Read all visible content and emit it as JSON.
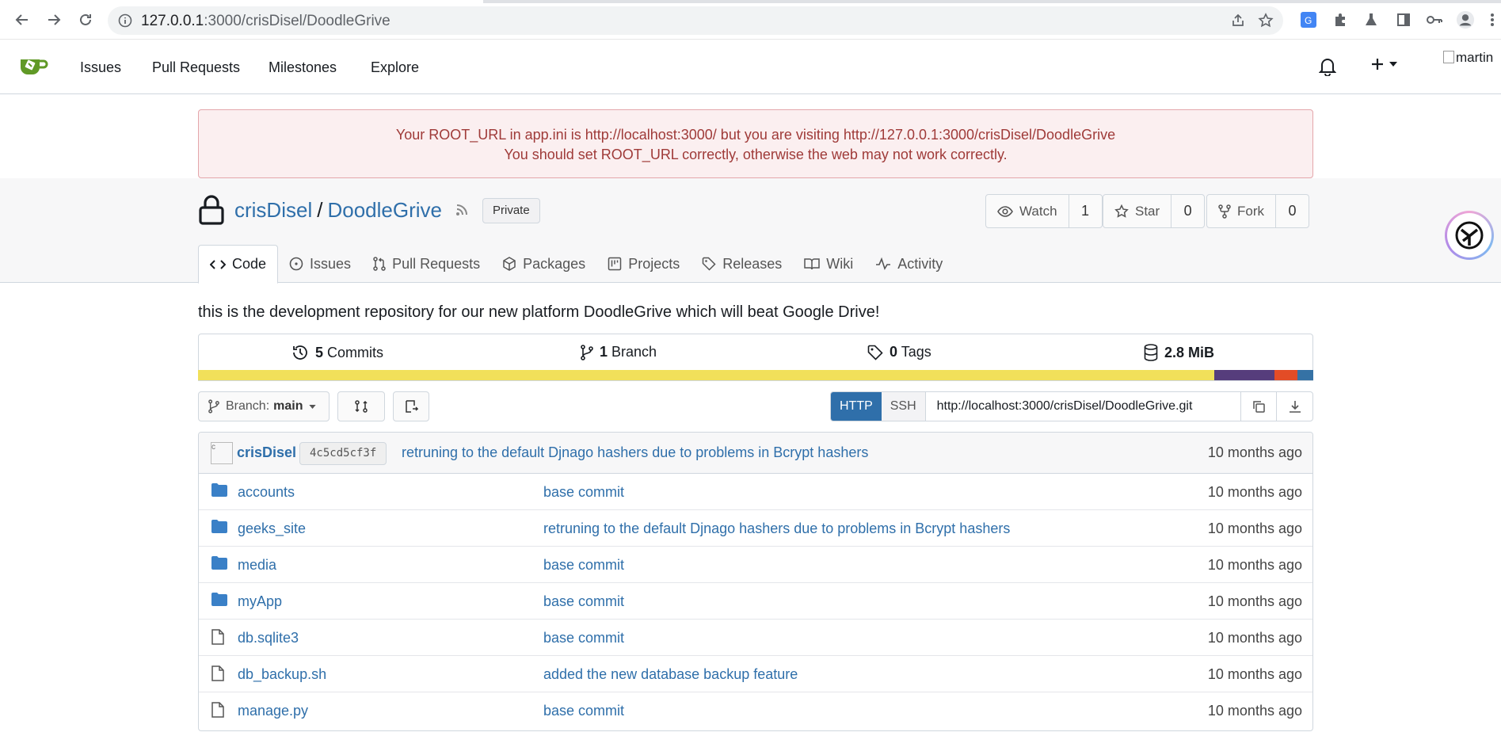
{
  "browser": {
    "url_host": "127.0.0.1",
    "url_path": ":3000/crisDisel/DoodleGrive"
  },
  "navbar": {
    "links": [
      "Issues",
      "Pull Requests",
      "Milestones",
      "Explore"
    ],
    "avatar_alt": "martin"
  },
  "warning": {
    "line1": "Your ROOT_URL in app.ini is http://localhost:3000/ but you are visiting http://127.0.0.1:3000/crisDisel/DoodleGrive",
    "line2": "You should set ROOT_URL correctly, otherwise the web may not work correctly."
  },
  "repo": {
    "owner": "crisDisel",
    "separator": "/",
    "name": "DoodleGrive",
    "visibility": "Private",
    "watch_label": "Watch",
    "watch_count": "1",
    "star_label": "Star",
    "star_count": "0",
    "fork_label": "Fork",
    "fork_count": "0",
    "description": "this is the development repository for our new platform DoodleGrive which will beat Google Drive!"
  },
  "tabs": [
    "Code",
    "Issues",
    "Pull Requests",
    "Packages",
    "Projects",
    "Releases",
    "Wiki",
    "Activity"
  ],
  "stats": {
    "commits_num": "5",
    "commits_label": "Commits",
    "branches_num": "1",
    "branches_label": "Branch",
    "tags_num": "0",
    "tags_label": "Tags",
    "size": "2.8 MiB"
  },
  "languages": [
    {
      "color": "#f1e05a",
      "fraction": 0.911
    },
    {
      "color": "#563d7c",
      "fraction": 0.054
    },
    {
      "color": "#e34c26",
      "fraction": 0.021
    },
    {
      "color": "#3572a5",
      "fraction": 0.014
    }
  ],
  "toolbar": {
    "branch_prefix": "Branch:",
    "branch_name": "main",
    "http_label": "HTTP",
    "ssh_label": "SSH",
    "clone_url": "http://localhost:3000/crisDisel/DoodleGrive.git"
  },
  "latest_commit": {
    "author": "crisDisel",
    "sha": "4c5cd5cf3f",
    "message": "retruning to the default Djnago hashers due to problems in Bcrypt hashers",
    "age": "10 months ago"
  },
  "files": [
    {
      "name": "accounts",
      "type": "folder",
      "message": "base commit",
      "age": "10 months ago"
    },
    {
      "name": "geeks_site",
      "type": "folder",
      "message": "retruning to the default Djnago hashers due to problems in Bcrypt hashers",
      "age": "10 months ago"
    },
    {
      "name": "media",
      "type": "folder",
      "message": "base commit",
      "age": "10 months ago"
    },
    {
      "name": "myApp",
      "type": "folder",
      "message": "base commit",
      "age": "10 months ago"
    },
    {
      "name": "db.sqlite3",
      "type": "file",
      "message": "base commit",
      "age": "10 months ago"
    },
    {
      "name": "db_backup.sh",
      "type": "file",
      "message": "added the new database backup feature",
      "age": "10 months ago"
    },
    {
      "name": "manage.py",
      "type": "file",
      "message": "base commit",
      "age": "10 months ago"
    }
  ],
  "colors": {
    "link": "#2f6faa",
    "accent_blue": "#2f6faa",
    "warning_text": "#9f3a38",
    "warning_bg": "#fbeff0",
    "gitea_green": "#609926"
  },
  "icons": [
    "back-arrow-icon",
    "forward-arrow-icon",
    "reload-icon",
    "info-icon",
    "share-icon",
    "star-icon",
    "translate-icon",
    "puzzle-icon",
    "lab-icon",
    "sidebar-icon",
    "key-icon",
    "profile-icon",
    "menu-dots-icon",
    "gitea-logo-icon",
    "bell-icon",
    "plus-icon",
    "lock-icon",
    "rss-icon",
    "eye-icon",
    "fork-icon",
    "history-icon",
    "branch-icon",
    "tag-icon",
    "database-icon",
    "compare-icon",
    "copy-icon",
    "download-icon",
    "folder-icon",
    "file-icon"
  ]
}
